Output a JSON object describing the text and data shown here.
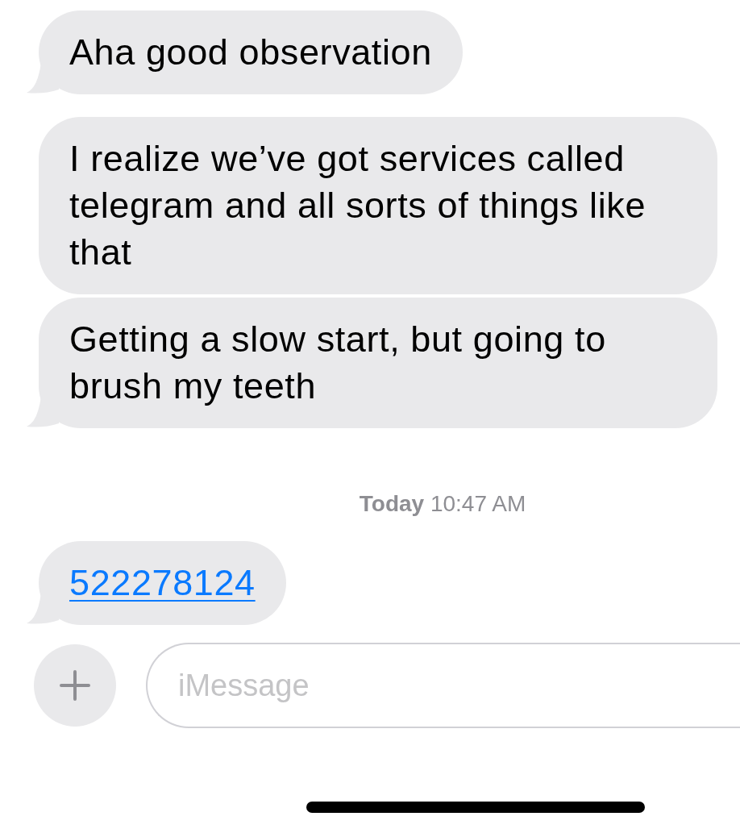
{
  "messages": [
    {
      "kind": "text",
      "text": "Aha good observation",
      "tail": true
    },
    {
      "kind": "text",
      "text": "I realize we’ve got services called telegram and all sorts of things like that",
      "tail": false
    },
    {
      "kind": "text",
      "text": "Getting a slow start, but going to brush my teeth",
      "tail": true
    },
    {
      "kind": "timestamp",
      "text": "**Today** 10:47 AM"
    },
    {
      "kind": "link",
      "text": "522278124",
      "tail": true
    }
  ],
  "composer": {
    "placeholder": "iMessage"
  }
}
